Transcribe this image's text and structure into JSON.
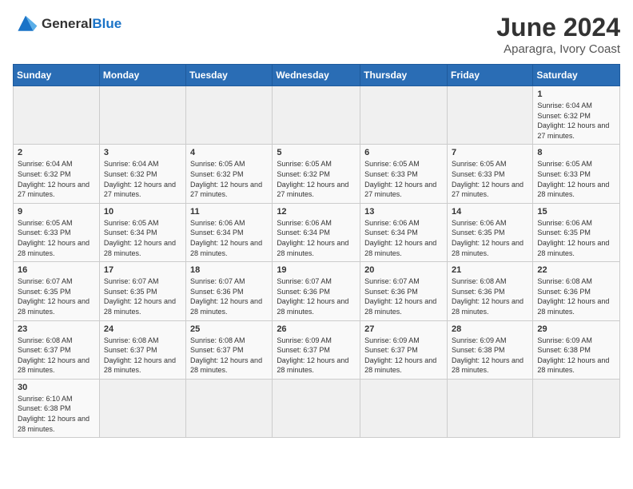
{
  "header": {
    "logo_general": "General",
    "logo_blue": "Blue",
    "month_title": "June 2024",
    "location": "Aparagra, Ivory Coast"
  },
  "weekdays": [
    "Sunday",
    "Monday",
    "Tuesday",
    "Wednesday",
    "Thursday",
    "Friday",
    "Saturday"
  ],
  "weeks": [
    [
      {
        "day": "",
        "info": ""
      },
      {
        "day": "",
        "info": ""
      },
      {
        "day": "",
        "info": ""
      },
      {
        "day": "",
        "info": ""
      },
      {
        "day": "",
        "info": ""
      },
      {
        "day": "",
        "info": ""
      },
      {
        "day": "1",
        "info": "Sunrise: 6:04 AM\nSunset: 6:32 PM\nDaylight: 12 hours and 27 minutes."
      }
    ],
    [
      {
        "day": "2",
        "info": "Sunrise: 6:04 AM\nSunset: 6:32 PM\nDaylight: 12 hours and 27 minutes."
      },
      {
        "day": "3",
        "info": "Sunrise: 6:04 AM\nSunset: 6:32 PM\nDaylight: 12 hours and 27 minutes."
      },
      {
        "day": "4",
        "info": "Sunrise: 6:05 AM\nSunset: 6:32 PM\nDaylight: 12 hours and 27 minutes."
      },
      {
        "day": "5",
        "info": "Sunrise: 6:05 AM\nSunset: 6:32 PM\nDaylight: 12 hours and 27 minutes."
      },
      {
        "day": "6",
        "info": "Sunrise: 6:05 AM\nSunset: 6:33 PM\nDaylight: 12 hours and 27 minutes."
      },
      {
        "day": "7",
        "info": "Sunrise: 6:05 AM\nSunset: 6:33 PM\nDaylight: 12 hours and 27 minutes."
      },
      {
        "day": "8",
        "info": "Sunrise: 6:05 AM\nSunset: 6:33 PM\nDaylight: 12 hours and 28 minutes."
      }
    ],
    [
      {
        "day": "9",
        "info": "Sunrise: 6:05 AM\nSunset: 6:33 PM\nDaylight: 12 hours and 28 minutes."
      },
      {
        "day": "10",
        "info": "Sunrise: 6:05 AM\nSunset: 6:34 PM\nDaylight: 12 hours and 28 minutes."
      },
      {
        "day": "11",
        "info": "Sunrise: 6:06 AM\nSunset: 6:34 PM\nDaylight: 12 hours and 28 minutes."
      },
      {
        "day": "12",
        "info": "Sunrise: 6:06 AM\nSunset: 6:34 PM\nDaylight: 12 hours and 28 minutes."
      },
      {
        "day": "13",
        "info": "Sunrise: 6:06 AM\nSunset: 6:34 PM\nDaylight: 12 hours and 28 minutes."
      },
      {
        "day": "14",
        "info": "Sunrise: 6:06 AM\nSunset: 6:35 PM\nDaylight: 12 hours and 28 minutes."
      },
      {
        "day": "15",
        "info": "Sunrise: 6:06 AM\nSunset: 6:35 PM\nDaylight: 12 hours and 28 minutes."
      }
    ],
    [
      {
        "day": "16",
        "info": "Sunrise: 6:07 AM\nSunset: 6:35 PM\nDaylight: 12 hours and 28 minutes."
      },
      {
        "day": "17",
        "info": "Sunrise: 6:07 AM\nSunset: 6:35 PM\nDaylight: 12 hours and 28 minutes."
      },
      {
        "day": "18",
        "info": "Sunrise: 6:07 AM\nSunset: 6:36 PM\nDaylight: 12 hours and 28 minutes."
      },
      {
        "day": "19",
        "info": "Sunrise: 6:07 AM\nSunset: 6:36 PM\nDaylight: 12 hours and 28 minutes."
      },
      {
        "day": "20",
        "info": "Sunrise: 6:07 AM\nSunset: 6:36 PM\nDaylight: 12 hours and 28 minutes."
      },
      {
        "day": "21",
        "info": "Sunrise: 6:08 AM\nSunset: 6:36 PM\nDaylight: 12 hours and 28 minutes."
      },
      {
        "day": "22",
        "info": "Sunrise: 6:08 AM\nSunset: 6:36 PM\nDaylight: 12 hours and 28 minutes."
      }
    ],
    [
      {
        "day": "23",
        "info": "Sunrise: 6:08 AM\nSunset: 6:37 PM\nDaylight: 12 hours and 28 minutes."
      },
      {
        "day": "24",
        "info": "Sunrise: 6:08 AM\nSunset: 6:37 PM\nDaylight: 12 hours and 28 minutes."
      },
      {
        "day": "25",
        "info": "Sunrise: 6:08 AM\nSunset: 6:37 PM\nDaylight: 12 hours and 28 minutes."
      },
      {
        "day": "26",
        "info": "Sunrise: 6:09 AM\nSunset: 6:37 PM\nDaylight: 12 hours and 28 minutes."
      },
      {
        "day": "27",
        "info": "Sunrise: 6:09 AM\nSunset: 6:37 PM\nDaylight: 12 hours and 28 minutes."
      },
      {
        "day": "28",
        "info": "Sunrise: 6:09 AM\nSunset: 6:38 PM\nDaylight: 12 hours and 28 minutes."
      },
      {
        "day": "29",
        "info": "Sunrise: 6:09 AM\nSunset: 6:38 PM\nDaylight: 12 hours and 28 minutes."
      }
    ],
    [
      {
        "day": "30",
        "info": "Sunrise: 6:10 AM\nSunset: 6:38 PM\nDaylight: 12 hours and 28 minutes."
      },
      {
        "day": "",
        "info": ""
      },
      {
        "day": "",
        "info": ""
      },
      {
        "day": "",
        "info": ""
      },
      {
        "day": "",
        "info": ""
      },
      {
        "day": "",
        "info": ""
      },
      {
        "day": "",
        "info": ""
      }
    ]
  ]
}
